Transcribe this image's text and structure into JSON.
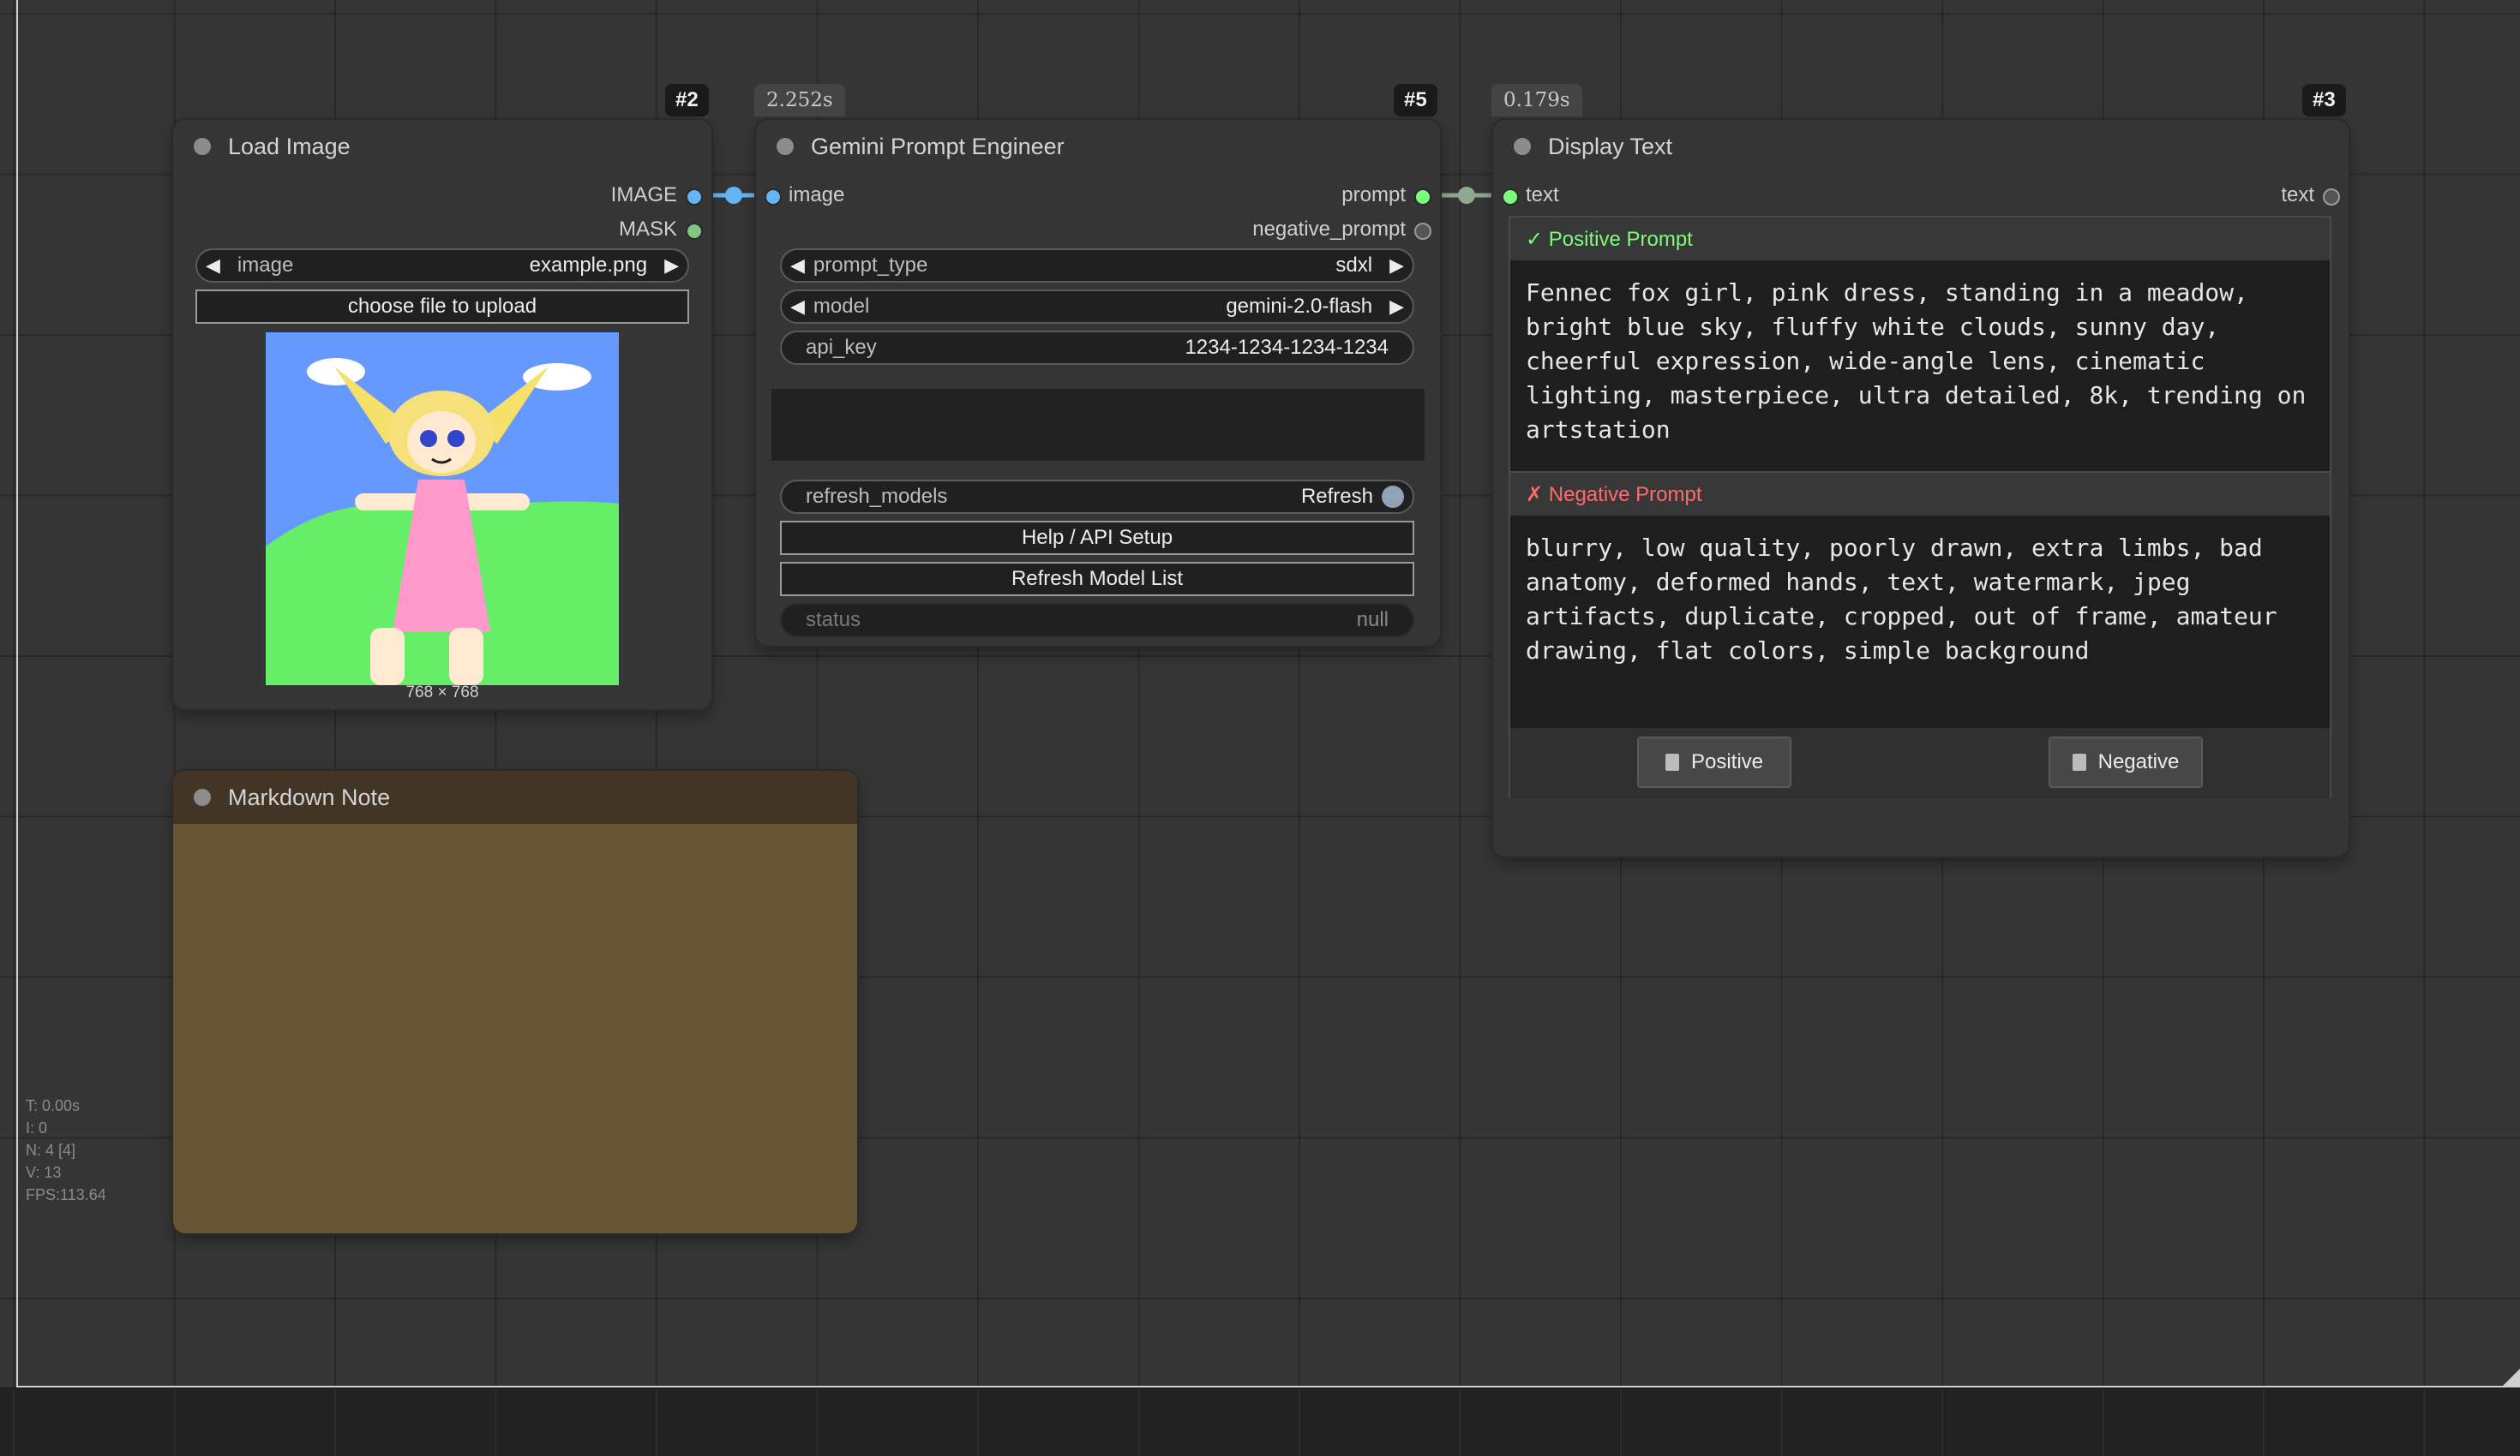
{
  "nodes": {
    "load_image": {
      "id_badge": "#2",
      "title": "Load Image",
      "outputs": [
        "IMAGE",
        "MASK"
      ],
      "image_widget": {
        "label": "image",
        "value": "example.png"
      },
      "upload_button": "choose file to upload",
      "image_size": "768 × 768"
    },
    "gemini": {
      "id_badge": "#5",
      "time": "2.252s",
      "title": "Gemini Prompt Engineer",
      "input": "image",
      "outputs": [
        "prompt",
        "negative_prompt"
      ],
      "prompt_type": {
        "label": "prompt_type",
        "value": "sdxl"
      },
      "model": {
        "label": "model",
        "value": "gemini-2.0-flash"
      },
      "api_key": {
        "label": "api_key",
        "value": "1234-1234-1234-1234"
      },
      "refresh_models": {
        "label": "refresh_models",
        "value": "Refresh"
      },
      "help_button": "Help / API Setup",
      "refresh_list_button": "Refresh Model List",
      "status": {
        "label": "status",
        "value": "null"
      }
    },
    "display_text": {
      "id_badge": "#3",
      "time": "0.179s",
      "title": "Display Text",
      "input": "text",
      "output": "text",
      "positive_header": "✓ Positive Prompt",
      "positive_text": "Fennec fox girl, pink dress, standing in a meadow, bright blue sky, fluffy white clouds, sunny day, cheerful expression, wide-angle lens, cinematic lighting, masterpiece, ultra detailed, 8k, trending on artstation",
      "negative_header": "✗ Negative Prompt",
      "negative_text": "blurry, low quality, poorly drawn, extra limbs, bad anatomy, deformed hands, text, watermark, jpeg artifacts, duplicate, cropped, out of frame, amateur drawing, flat colors, simple background",
      "positive_button": "Positive",
      "negative_button": "Negative",
      "clipboard_icon": "clipboard-icon"
    },
    "markdown_note": {
      "title": "Markdown Note"
    }
  },
  "stats": [
    "T: 0.00s",
    "I: 0",
    "N: 4 [4]",
    "V: 13",
    "FPS:113.64"
  ],
  "colors": {
    "image_link": "#64b5f6",
    "prompt_link": "#8fa98f",
    "positive": "#7cfc7c",
    "negative": "#ff6b6b",
    "note_body": "#665533",
    "note_title": "#433526"
  }
}
